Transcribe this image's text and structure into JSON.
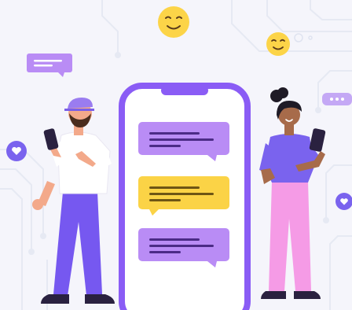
{
  "scene": {
    "illustration": "messaging-chat-illustration",
    "colors": {
      "background": "#f5f5fb",
      "circuit": "#e6e9f3",
      "phone_frame": "#8a5cf5",
      "bubble_purple": "#b98cf5",
      "bubble_yellow": "#fbd346",
      "emoji": "#fcd448",
      "man_pants": "#7658f0",
      "woman_pants": "#f59be6",
      "woman_shirt": "#7a63ee",
      "cap": "#9a7cf0"
    },
    "icons": [
      "smile-emoji-icon",
      "heart-icon",
      "ellipsis-icon",
      "chat-bubble-icon",
      "smartphone-icon"
    ]
  }
}
